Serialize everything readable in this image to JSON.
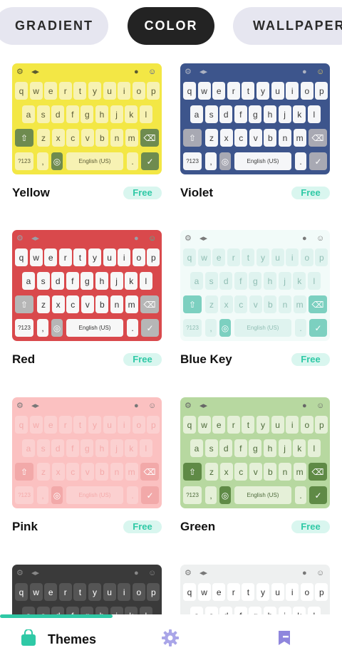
{
  "tabs": [
    "GRADIENT",
    "COLOR",
    "WALLPAPER"
  ],
  "keyboard": {
    "row1": [
      "q",
      "w",
      "e",
      "r",
      "t",
      "y",
      "u",
      "i",
      "o",
      "p"
    ],
    "row2": [
      "a",
      "s",
      "d",
      "f",
      "g",
      "h",
      "j",
      "k",
      "l"
    ],
    "row3": [
      "z",
      "x",
      "c",
      "v",
      "b",
      "n",
      "m"
    ],
    "num_label": "?123",
    "comma": ",",
    "space_label": "English (US)",
    "period": "."
  },
  "themes": [
    {
      "name": "Yellow",
      "badge": "Free",
      "colors": {
        "bg": "#f3e745",
        "key": "#f7f2b3",
        "text": "#5b5b34",
        "special": "#6e8b4f",
        "special_text": "#ffffff",
        "enter": "#6e8b4f",
        "space": "#f7f2b3",
        "icon": "#5a5a30",
        "emoji": "#2f3fae"
      }
    },
    {
      "name": "Violet",
      "badge": "Free",
      "colors": {
        "bg": "#3d558c",
        "key": "#f5f6f8",
        "text": "#3b3b3b",
        "special": "#a8a9b3",
        "special_text": "#ffffff",
        "enter": "#a8a9b3",
        "space": "#f5f6f8",
        "icon": "#aeb3c2",
        "emoji": "#e0c862"
      }
    },
    {
      "name": "Red",
      "badge": "Free",
      "colors": {
        "bg": "#d9494c",
        "key": "#f7f7f7",
        "text": "#333333",
        "special": "#b6b6b6",
        "special_text": "#ffffff",
        "enter": "#b6b6b6",
        "space": "#f7f7f7",
        "icon": "#9aa0a8",
        "emoji": "#2fc9a6"
      }
    },
    {
      "name": "Blue Key",
      "badge": "Free",
      "colors": {
        "bg": "#f2fbf9",
        "key": "#dff3ef",
        "text": "#8fbdb3",
        "special": "#7cd0c0",
        "special_text": "#ffffff",
        "enter": "#7cd0c0",
        "space": "#dff3ef",
        "icon": "#7a7a7a",
        "emoji": "#7a7a7a"
      }
    },
    {
      "name": "Pink",
      "badge": "Free",
      "colors": {
        "bg": "#fbc1c1",
        "key": "#fbd0d0",
        "text": "#f4aaaa",
        "special": "#f2a9a9",
        "special_text": "#ffffff",
        "enter": "#f2a9a9",
        "space": "#fbd0d0",
        "icon": "#777777",
        "emoji": "#777777"
      }
    },
    {
      "name": "Green",
      "badge": "Free",
      "colors": {
        "bg": "#b7d8a0",
        "key": "#e5f0d8",
        "text": "#4d6a3a",
        "special": "#5f8a46",
        "special_text": "#ffffff",
        "enter": "#5f8a46",
        "space": "#e5f0d8",
        "icon": "#666666",
        "emoji": "#666666"
      }
    },
    {
      "name": "",
      "badge": "",
      "colors": {
        "bg": "#3a3a3a",
        "key": "#555555",
        "text": "#ffffff",
        "special": "#555555",
        "special_text": "#ffffff",
        "enter": "#555555",
        "space": "#555555",
        "icon": "#888888",
        "emoji": "#888888"
      }
    },
    {
      "name": "",
      "badge": "",
      "colors": {
        "bg": "#eef0f0",
        "key": "#ffffff",
        "text": "#333333",
        "special": "#d0d2d4",
        "special_text": "#ffffff",
        "enter": "#d0d2d4",
        "space": "#ffffff",
        "icon": "#777777",
        "emoji": "#777777"
      }
    }
  ],
  "bottom_nav": {
    "themes_label": "Themes",
    "accent": "#2fc9a6",
    "settings_color": "#a9a5e8",
    "bookmark_color": "#8f86dd"
  }
}
